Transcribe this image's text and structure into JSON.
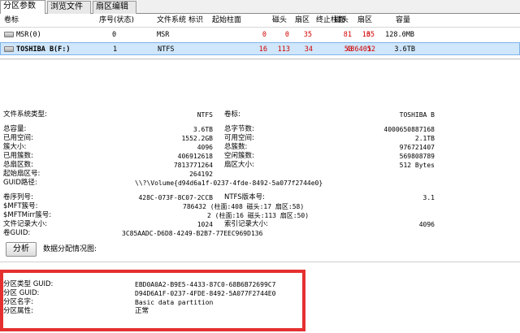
{
  "tabs": [
    "分区参数",
    "浏览文件",
    "扇区编辑"
  ],
  "table": {
    "columns": [
      "卷标",
      "序号(状态)",
      "文件系统",
      "标识",
      "起始柱面",
      "磁头",
      "扇区",
      "终止柱面",
      "磁头",
      "扇区",
      "容量"
    ],
    "rows": [
      {
        "volume": "MSR(0)",
        "seq": "0",
        "fs": "MSR",
        "flag": "",
        "start_cyl": "0",
        "start_head": "0",
        "start_sector": "35",
        "end_cyl": "16",
        "end_head": "81",
        "end_sector": "35",
        "capacity": "128.0MB"
      },
      {
        "volume": "TOSHIBA B(F:)",
        "seq": "1",
        "fs": "NTFS",
        "flag": "",
        "start_cyl": "16",
        "start_head": "113",
        "start_sector": "34",
        "end_cyl": "486401",
        "end_head": "53",
        "end_sector": "52",
        "capacity": "3.6TB"
      }
    ]
  },
  "fs_info": {
    "fs_type_label": "文件系统类型:",
    "fs_type": "NTFS",
    "vol_label_label": "卷标:",
    "vol_label": "TOSHIBA B",
    "total_cap_label": "总容量:",
    "total_cap": "3.6TB",
    "total_bytes_label": "总字节数:",
    "total_bytes": "4000650887168",
    "used_label": "已用空间:",
    "used": "1552.2GB",
    "free_label": "可用空间:",
    "free": "2.1TB",
    "cluster_size_label": "簇大小:",
    "cluster_size": "4096",
    "total_clusters_label": "总簇数:",
    "total_clusters": "976721407",
    "used_clusters_label": "已用簇数:",
    "used_clusters": "406912618",
    "free_clusters_label": "空闲簇数:",
    "free_clusters": "569808789",
    "total_sectors_label": "总扇区数:",
    "total_sectors": "7813771264",
    "sector_size_label": "扇区大小:",
    "sector_size": "512 Bytes",
    "start_sector_label": "起始扇区号:",
    "start_sector": "264192",
    "guid_path_label": "GUID路径:",
    "guid_path": "\\\\?\\Volume{d94d6a1f-0237-4fde-8492-5a077f2744e0}"
  },
  "ntfs_info": {
    "serial_label": "卷序列号:",
    "serial": "428C-073F-8C07-2CCB",
    "ntfs_ver_label": "NTFS版本号:",
    "ntfs_ver": "3.1",
    "mft_label": "$MFT簇号:",
    "mft": "786432 (柱面:408 磁头:17 扇区:58)",
    "mftmirr_label": "$MFTMirr簇号:",
    "mftmirr": "2 (柱面:16 磁头:113 扇区:50)",
    "rec_size_label": "文件记录大小:",
    "rec_size": "1024",
    "idx_size_label": "索引记录大小:",
    "idx_size": "4096",
    "vol_guid_label": "卷GUID:",
    "vol_guid": "3C85AADC-D6D8-4249-B2B7-77EEC969D136"
  },
  "analyze_button": "分析",
  "data_map_label": "数据分配情况图:",
  "partition_guid": {
    "type_label": "分区类型 GUID:",
    "type": "EBD0A0A2-B9E5-4433-87C0-68B6B72699C7",
    "guid_label": "分区 GUID:",
    "guid": "D94D6A1F-0237-4FDE-8492-5A077F2744E0",
    "name_label": "分区名字:",
    "name": "Basic data partition",
    "attr_label": "分区属性:",
    "attr": "正常"
  },
  "colors": {
    "highlight_box": "#e53030",
    "selected_row": "#cfe6fb",
    "red_text": "#d00000"
  }
}
